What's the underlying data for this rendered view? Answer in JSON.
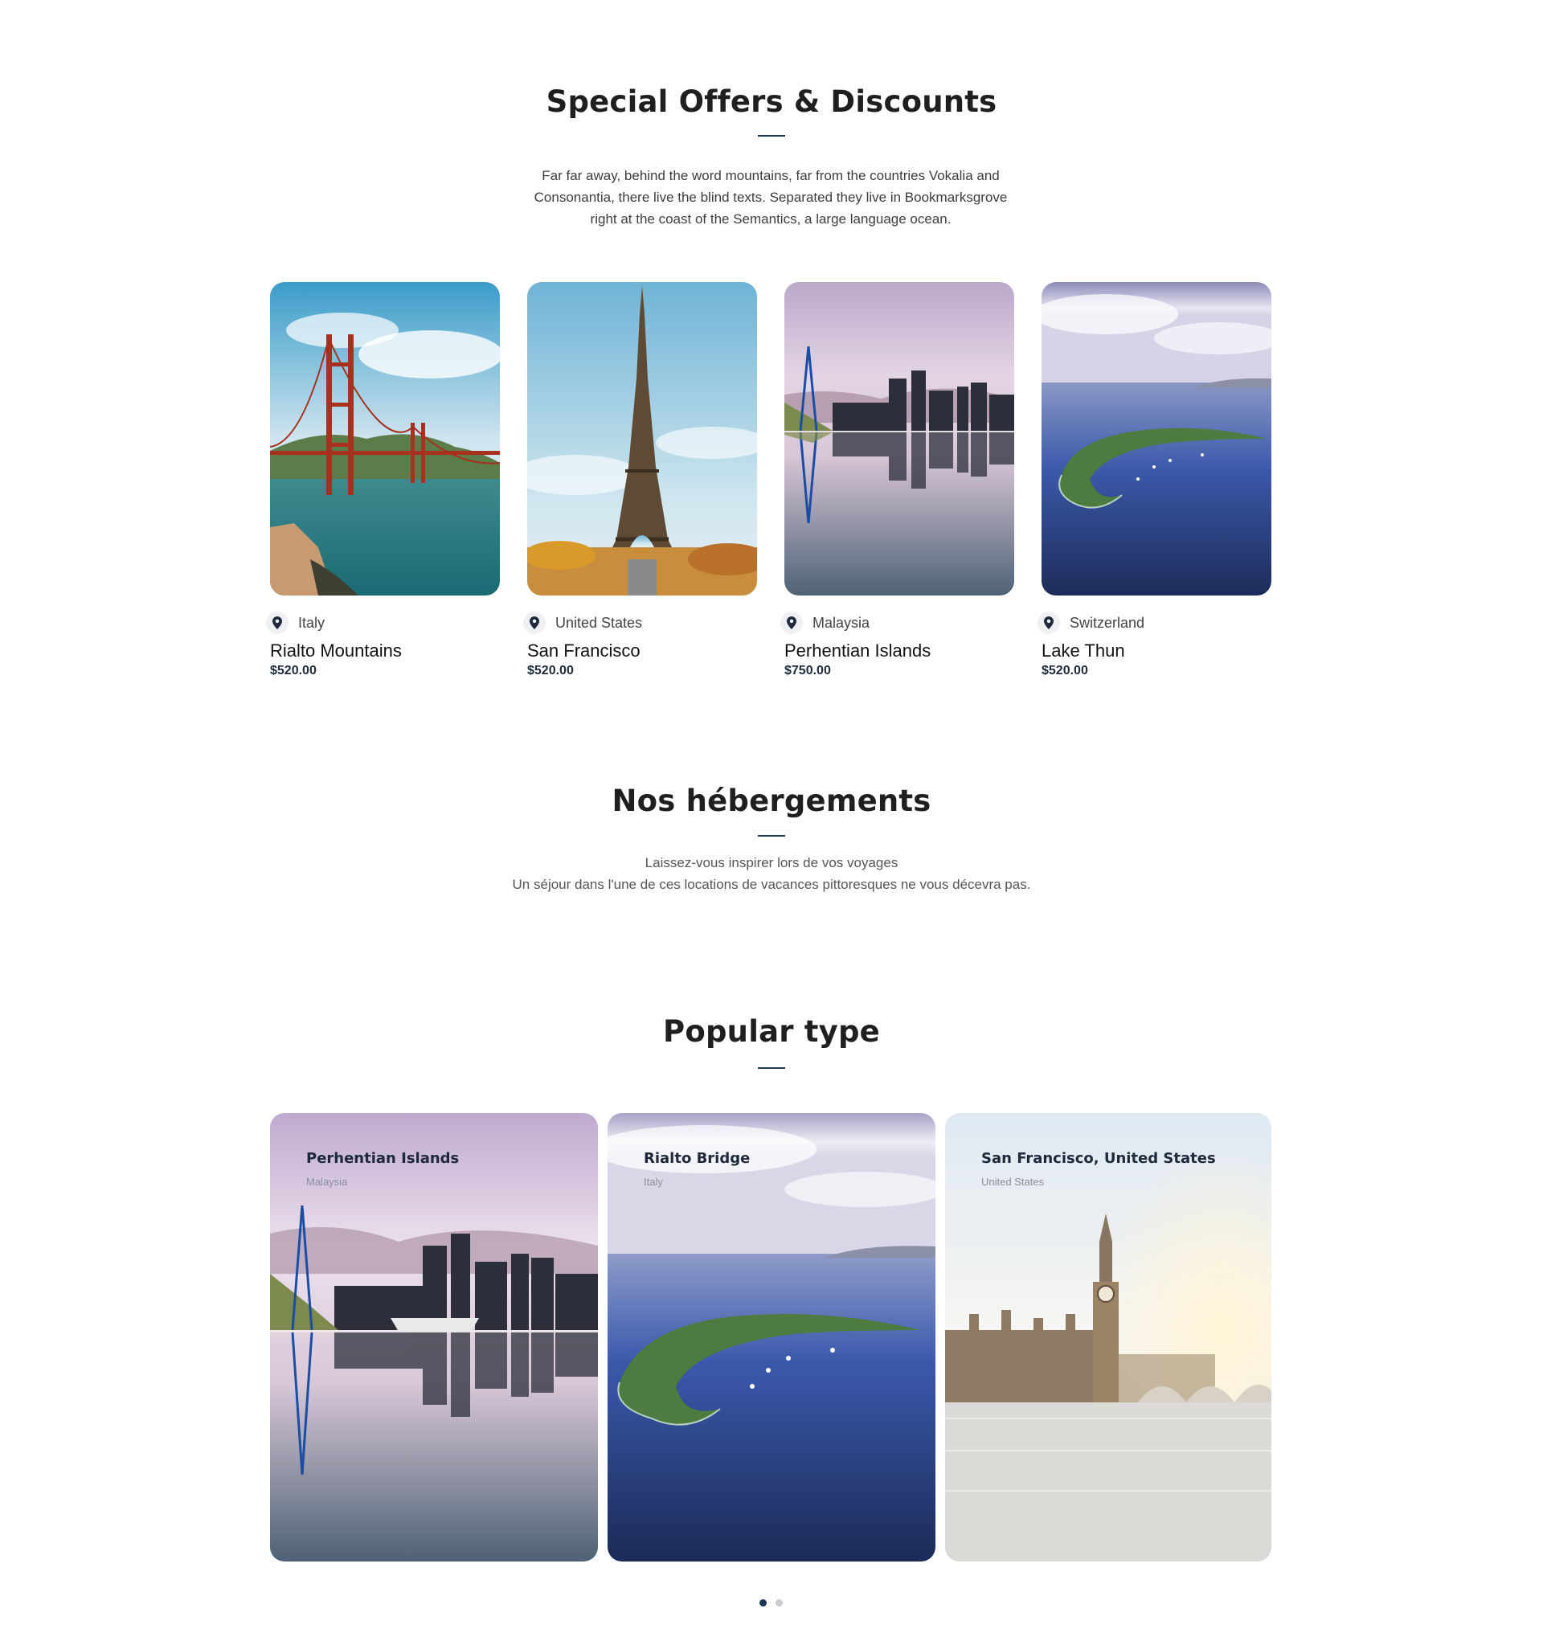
{
  "offers": {
    "title": "Special Offers & Discounts",
    "description": "Far far away, behind the word mountains, far from the countries Vokalia and Consonantia, there live the blind texts. Separated they live in Bookmarksgrove right at the coast of the Semantics, a large language ocean.",
    "cards": [
      {
        "country": "Italy",
        "name": "Rialto Mountains",
        "price": "$520.00",
        "image": "golden-gate-bridge-photo"
      },
      {
        "country": "United States",
        "name": "San Francisco",
        "price": "$520.00",
        "image": "eiffel-tower-photo"
      },
      {
        "country": "Malaysia",
        "name": "Perhentian Islands",
        "price": "$750.00",
        "image": "city-skyline-reflection-photo"
      },
      {
        "country": "Switzerland",
        "name": "Lake Thun",
        "price": "$520.00",
        "image": "crescent-island-ocean-photo"
      }
    ]
  },
  "hebergements": {
    "title": "Nos hébergements",
    "line1": "Laissez-vous inspirer lors de vos voyages",
    "line2": "Un séjour dans l'une de ces locations de vacances pittoresques ne vous décevra pas."
  },
  "popular": {
    "title": "Popular type",
    "cards": [
      {
        "title": "Perhentian Islands",
        "subtitle": "Malaysia",
        "image": "city-skyline-reflection-photo"
      },
      {
        "title": "Rialto Bridge",
        "subtitle": "Italy",
        "image": "crescent-island-ocean-photo"
      },
      {
        "title": "San Francisco, United States",
        "subtitle": "United States",
        "image": "big-ben-westminster-photo"
      }
    ],
    "carousel_pages": 2,
    "active_page": 1
  },
  "colors": {
    "accent": "#1e3553",
    "heading": "#1f1f1f",
    "price": "#1d2b3a"
  }
}
